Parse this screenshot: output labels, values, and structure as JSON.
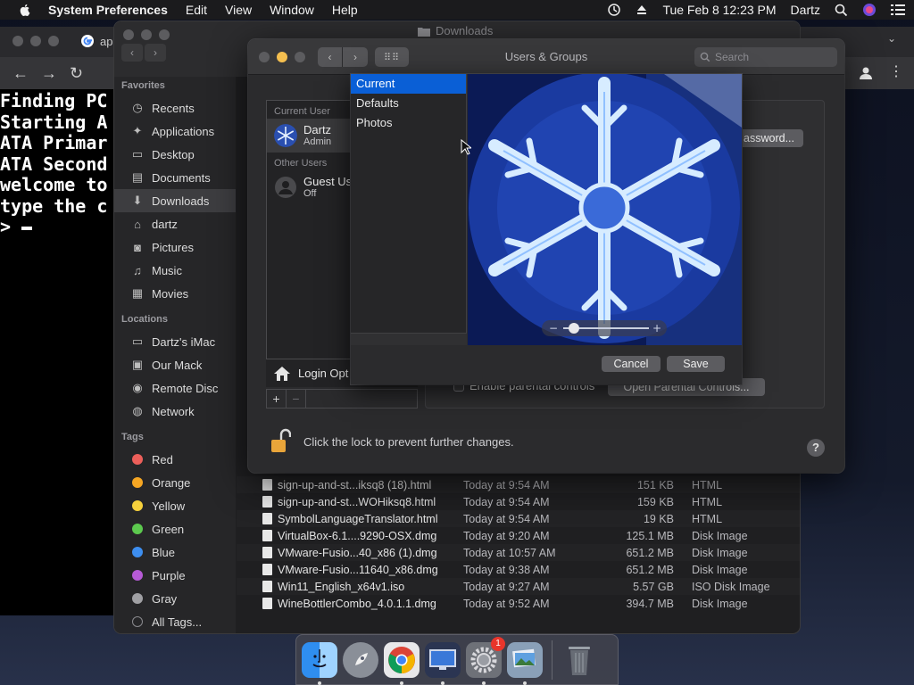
{
  "menubar": {
    "app_name": "System Preferences",
    "menus": [
      "Edit",
      "View",
      "Window",
      "Help"
    ],
    "date_time": "Tue Feb 8  12:23 PM",
    "user": "Dartz"
  },
  "browser": {
    "tab_label": "ap",
    "terminal_lines": [
      "Finding PC",
      "Starting A",
      "ATA Primar",
      "ATA Second",
      "welcome to",
      "type the c",
      ">"
    ]
  },
  "finder": {
    "title": "Downloads",
    "sidebar": {
      "favorites_header": "Favorites",
      "favorites": [
        {
          "label": "Recents",
          "icon": "clock-icon"
        },
        {
          "label": "Applications",
          "icon": "applications-icon"
        },
        {
          "label": "Desktop",
          "icon": "desktop-icon"
        },
        {
          "label": "Documents",
          "icon": "document-icon"
        },
        {
          "label": "Downloads",
          "icon": "download-icon"
        },
        {
          "label": "dartz",
          "icon": "home-icon"
        },
        {
          "label": "Pictures",
          "icon": "camera-icon"
        },
        {
          "label": "Music",
          "icon": "music-note-icon"
        },
        {
          "label": "Movies",
          "icon": "film-icon"
        }
      ],
      "locations_header": "Locations",
      "locations": [
        {
          "label": "Dartz's iMac",
          "icon": "imac-icon"
        },
        {
          "label": "Our Mack",
          "icon": "disk-icon"
        },
        {
          "label": "Remote Disc",
          "icon": "disc-icon"
        },
        {
          "label": "Network",
          "icon": "globe-icon"
        }
      ],
      "tags_header": "Tags",
      "tags": [
        {
          "label": "Red",
          "color": "#ec5f5a"
        },
        {
          "label": "Orange",
          "color": "#f5a623"
        },
        {
          "label": "Yellow",
          "color": "#f7d13c"
        },
        {
          "label": "Green",
          "color": "#5cc94e"
        },
        {
          "label": "Blue",
          "color": "#3d8ef0"
        },
        {
          "label": "Purple",
          "color": "#b65ad6"
        },
        {
          "label": "Gray",
          "color": "#a0a0a4"
        }
      ],
      "all_tags": "All Tags..."
    },
    "files": [
      {
        "name": "sign-up-and-st...iksq8 (18).html",
        "date": "Today at 9:54 AM",
        "size": "151 KB",
        "kind": "HTML"
      },
      {
        "name": "sign-up-and-st...WOHiksq8.html",
        "date": "Today at 9:54 AM",
        "size": "159 KB",
        "kind": "HTML"
      },
      {
        "name": "SymbolLanguageTranslator.html",
        "date": "Today at 9:54 AM",
        "size": "19 KB",
        "kind": "HTML"
      },
      {
        "name": "VirtualBox-6.1....9290-OSX.dmg",
        "date": "Today at 9:20 AM",
        "size": "125.1 MB",
        "kind": "Disk Image"
      },
      {
        "name": "VMware-Fusio...40_x86 (1).dmg",
        "date": "Today at 10:57 AM",
        "size": "651.2 MB",
        "kind": "Disk Image"
      },
      {
        "name": "VMware-Fusio...11640_x86.dmg",
        "date": "Today at 9:38 AM",
        "size": "651.2 MB",
        "kind": "Disk Image"
      },
      {
        "name": "Win11_English_x64v1.iso",
        "date": "Today at 9:27 AM",
        "size": "5.57 GB",
        "kind": "ISO Disk Image"
      },
      {
        "name": "WineBottlerCombo_4.0.1.1.dmg",
        "date": "Today at 9:52 AM",
        "size": "394.7 MB",
        "kind": "Disk Image"
      }
    ]
  },
  "sysprefs": {
    "title": "Users & Groups",
    "search_placeholder": "Search",
    "current_user_header": "Current User",
    "current_user": {
      "name": "Dartz",
      "role": "Admin"
    },
    "other_users_header": "Other Users",
    "guest_user": {
      "name": "Guest Us",
      "status": "Off"
    },
    "login_options": "Login Opt",
    "change_password_label": "assword...",
    "parental_label": "Enable parental controls",
    "open_parental_label": "Open Parental Controls...",
    "lock_text": "Click the lock to prevent further changes.",
    "help_label": "?"
  },
  "picture_editor": {
    "sources": [
      "Current",
      "Defaults",
      "Photos"
    ],
    "selected_index": 0,
    "cancel_label": "Cancel",
    "save_label": "Save"
  },
  "dock": {
    "apps": [
      {
        "name": "finder-icon",
        "color": "#3a8ee6"
      },
      {
        "name": "launchpad-icon",
        "color": "#8a8f98"
      },
      {
        "name": "chrome-icon",
        "color": "#ffffff"
      },
      {
        "name": "remote-desktop-icon",
        "color": "#3c4e7a"
      },
      {
        "name": "system-preferences-icon",
        "color": "#7d7f85"
      },
      {
        "name": "preview-icon",
        "color": "#8aa0b8"
      }
    ],
    "sysprefs_badge": "1"
  }
}
